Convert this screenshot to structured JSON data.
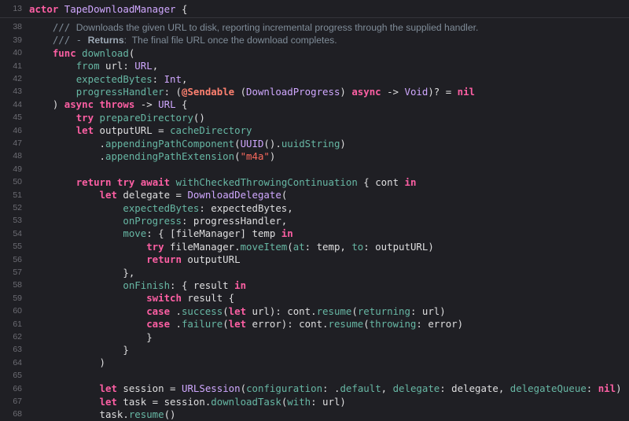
{
  "header": {
    "line_no": "13",
    "parts": [
      {
        "c": "kw",
        "t": "actor"
      },
      {
        "c": "plain",
        "t": " "
      },
      {
        "c": "tp",
        "t": "TapeDownloadManager"
      },
      {
        "c": "plain",
        "t": " {"
      }
    ]
  },
  "lines": [
    {
      "n": "38",
      "p": [
        {
          "c": "plain",
          "t": "    "
        },
        {
          "c": "cmt",
          "t": "/// "
        },
        {
          "c": "doc",
          "t": "Downloads the given URL to disk, reporting incremental progress through the supplied handler."
        }
      ]
    },
    {
      "n": "39",
      "p": [
        {
          "c": "plain",
          "t": "    "
        },
        {
          "c": "cmt",
          "t": "/// - "
        },
        {
          "c": "doc-b",
          "t": "Returns"
        },
        {
          "c": "doc",
          "t": ":  The final file URL once the download completes."
        }
      ]
    },
    {
      "n": "40",
      "p": [
        {
          "c": "plain",
          "t": "    "
        },
        {
          "c": "kw",
          "t": "func"
        },
        {
          "c": "plain",
          "t": " "
        },
        {
          "c": "fn",
          "t": "download"
        },
        {
          "c": "plain",
          "t": "("
        }
      ]
    },
    {
      "n": "41",
      "p": [
        {
          "c": "plain",
          "t": "        "
        },
        {
          "c": "prop",
          "t": "from"
        },
        {
          "c": "plain",
          "t": " url: "
        },
        {
          "c": "tp",
          "t": "URL"
        },
        {
          "c": "plain",
          "t": ","
        }
      ]
    },
    {
      "n": "42",
      "p": [
        {
          "c": "plain",
          "t": "        "
        },
        {
          "c": "prop",
          "t": "expectedBytes"
        },
        {
          "c": "plain",
          "t": ": "
        },
        {
          "c": "tp",
          "t": "Int"
        },
        {
          "c": "plain",
          "t": ","
        }
      ]
    },
    {
      "n": "43",
      "p": [
        {
          "c": "plain",
          "t": "        "
        },
        {
          "c": "prop",
          "t": "progressHandler"
        },
        {
          "c": "plain",
          "t": ": ("
        },
        {
          "c": "attr",
          "t": "@Sendable"
        },
        {
          "c": "plain",
          "t": " ("
        },
        {
          "c": "tp",
          "t": "DownloadProgress"
        },
        {
          "c": "plain",
          "t": ") "
        },
        {
          "c": "kw",
          "t": "async"
        },
        {
          "c": "plain",
          "t": " -> "
        },
        {
          "c": "tp",
          "t": "Void"
        },
        {
          "c": "plain",
          "t": ")? = "
        },
        {
          "c": "kw",
          "t": "nil"
        }
      ]
    },
    {
      "n": "44",
      "p": [
        {
          "c": "plain",
          "t": "    ) "
        },
        {
          "c": "kw",
          "t": "async"
        },
        {
          "c": "plain",
          "t": " "
        },
        {
          "c": "kw",
          "t": "throws"
        },
        {
          "c": "plain",
          "t": " -> "
        },
        {
          "c": "tp",
          "t": "URL"
        },
        {
          "c": "plain",
          "t": " {"
        }
      ]
    },
    {
      "n": "45",
      "p": [
        {
          "c": "plain",
          "t": "        "
        },
        {
          "c": "kw",
          "t": "try"
        },
        {
          "c": "plain",
          "t": " "
        },
        {
          "c": "fn",
          "t": "prepareDirectory"
        },
        {
          "c": "plain",
          "t": "()"
        }
      ]
    },
    {
      "n": "46",
      "p": [
        {
          "c": "plain",
          "t": "        "
        },
        {
          "c": "kw",
          "t": "let"
        },
        {
          "c": "plain",
          "t": " outputURL = "
        },
        {
          "c": "prop",
          "t": "cacheDirectory"
        }
      ]
    },
    {
      "n": "47",
      "p": [
        {
          "c": "plain",
          "t": "            ."
        },
        {
          "c": "fn",
          "t": "appendingPathComponent"
        },
        {
          "c": "plain",
          "t": "("
        },
        {
          "c": "tp",
          "t": "UUID"
        },
        {
          "c": "plain",
          "t": "()."
        },
        {
          "c": "prop",
          "t": "uuidString"
        },
        {
          "c": "plain",
          "t": ")"
        }
      ]
    },
    {
      "n": "48",
      "p": [
        {
          "c": "plain",
          "t": "            ."
        },
        {
          "c": "fn",
          "t": "appendingPathExtension"
        },
        {
          "c": "plain",
          "t": "("
        },
        {
          "c": "str",
          "t": "\"m4a\""
        },
        {
          "c": "plain",
          "t": ")"
        }
      ]
    },
    {
      "n": "49",
      "p": []
    },
    {
      "n": "50",
      "p": [
        {
          "c": "plain",
          "t": "        "
        },
        {
          "c": "kw",
          "t": "return"
        },
        {
          "c": "plain",
          "t": " "
        },
        {
          "c": "kw",
          "t": "try"
        },
        {
          "c": "plain",
          "t": " "
        },
        {
          "c": "kw",
          "t": "await"
        },
        {
          "c": "plain",
          "t": " "
        },
        {
          "c": "fn",
          "t": "withCheckedThrowingContinuation"
        },
        {
          "c": "plain",
          "t": " { cont "
        },
        {
          "c": "kw",
          "t": "in"
        }
      ]
    },
    {
      "n": "51",
      "p": [
        {
          "c": "plain",
          "t": "            "
        },
        {
          "c": "kw",
          "t": "let"
        },
        {
          "c": "plain",
          "t": " delegate = "
        },
        {
          "c": "tp",
          "t": "DownloadDelegate"
        },
        {
          "c": "plain",
          "t": "("
        }
      ]
    },
    {
      "n": "52",
      "p": [
        {
          "c": "plain",
          "t": "                "
        },
        {
          "c": "prop",
          "t": "expectedBytes"
        },
        {
          "c": "plain",
          "t": ": expectedBytes,"
        }
      ]
    },
    {
      "n": "53",
      "p": [
        {
          "c": "plain",
          "t": "                "
        },
        {
          "c": "prop",
          "t": "onProgress"
        },
        {
          "c": "plain",
          "t": ": progressHandler,"
        }
      ]
    },
    {
      "n": "54",
      "p": [
        {
          "c": "plain",
          "t": "                "
        },
        {
          "c": "prop",
          "t": "move"
        },
        {
          "c": "plain",
          "t": ": { [fileManager] temp "
        },
        {
          "c": "kw",
          "t": "in"
        }
      ]
    },
    {
      "n": "55",
      "p": [
        {
          "c": "plain",
          "t": "                    "
        },
        {
          "c": "kw",
          "t": "try"
        },
        {
          "c": "plain",
          "t": " fileManager."
        },
        {
          "c": "fn",
          "t": "moveItem"
        },
        {
          "c": "plain",
          "t": "("
        },
        {
          "c": "prop",
          "t": "at"
        },
        {
          "c": "plain",
          "t": ": temp, "
        },
        {
          "c": "prop",
          "t": "to"
        },
        {
          "c": "plain",
          "t": ": outputURL)"
        }
      ]
    },
    {
      "n": "56",
      "p": [
        {
          "c": "plain",
          "t": "                    "
        },
        {
          "c": "kw",
          "t": "return"
        },
        {
          "c": "plain",
          "t": " outputURL"
        }
      ]
    },
    {
      "n": "57",
      "p": [
        {
          "c": "plain",
          "t": "                },"
        }
      ]
    },
    {
      "n": "58",
      "p": [
        {
          "c": "plain",
          "t": "                "
        },
        {
          "c": "prop",
          "t": "onFinish"
        },
        {
          "c": "plain",
          "t": ": { result "
        },
        {
          "c": "kw",
          "t": "in"
        }
      ]
    },
    {
      "n": "59",
      "p": [
        {
          "c": "plain",
          "t": "                    "
        },
        {
          "c": "kw",
          "t": "switch"
        },
        {
          "c": "plain",
          "t": " result {"
        }
      ]
    },
    {
      "n": "60",
      "p": [
        {
          "c": "plain",
          "t": "                    "
        },
        {
          "c": "kw",
          "t": "case"
        },
        {
          "c": "plain",
          "t": " ."
        },
        {
          "c": "prop",
          "t": "success"
        },
        {
          "c": "plain",
          "t": "("
        },
        {
          "c": "kw",
          "t": "let"
        },
        {
          "c": "plain",
          "t": " url): cont."
        },
        {
          "c": "fn",
          "t": "resume"
        },
        {
          "c": "plain",
          "t": "("
        },
        {
          "c": "prop",
          "t": "returning"
        },
        {
          "c": "plain",
          "t": ": url)"
        }
      ]
    },
    {
      "n": "61",
      "p": [
        {
          "c": "plain",
          "t": "                    "
        },
        {
          "c": "kw",
          "t": "case"
        },
        {
          "c": "plain",
          "t": " ."
        },
        {
          "c": "prop",
          "t": "failure"
        },
        {
          "c": "plain",
          "t": "("
        },
        {
          "c": "kw",
          "t": "let"
        },
        {
          "c": "plain",
          "t": " error): cont."
        },
        {
          "c": "fn",
          "t": "resume"
        },
        {
          "c": "plain",
          "t": "("
        },
        {
          "c": "prop",
          "t": "throwing"
        },
        {
          "c": "plain",
          "t": ": error)"
        }
      ]
    },
    {
      "n": "62",
      "p": [
        {
          "c": "plain",
          "t": "                    }"
        }
      ]
    },
    {
      "n": "63",
      "p": [
        {
          "c": "plain",
          "t": "                }"
        }
      ]
    },
    {
      "n": "64",
      "p": [
        {
          "c": "plain",
          "t": "            )"
        }
      ]
    },
    {
      "n": "65",
      "p": []
    },
    {
      "n": "66",
      "p": [
        {
          "c": "plain",
          "t": "            "
        },
        {
          "c": "kw",
          "t": "let"
        },
        {
          "c": "plain",
          "t": " session = "
        },
        {
          "c": "tp",
          "t": "URLSession"
        },
        {
          "c": "plain",
          "t": "("
        },
        {
          "c": "prop",
          "t": "configuration"
        },
        {
          "c": "plain",
          "t": ": ."
        },
        {
          "c": "prop",
          "t": "default"
        },
        {
          "c": "plain",
          "t": ", "
        },
        {
          "c": "prop",
          "t": "delegate"
        },
        {
          "c": "plain",
          "t": ": delegate, "
        },
        {
          "c": "prop",
          "t": "delegateQueue"
        },
        {
          "c": "plain",
          "t": ": "
        },
        {
          "c": "kw",
          "t": "nil"
        },
        {
          "c": "plain",
          "t": ")"
        }
      ]
    },
    {
      "n": "67",
      "p": [
        {
          "c": "plain",
          "t": "            "
        },
        {
          "c": "kw",
          "t": "let"
        },
        {
          "c": "plain",
          "t": " task = session."
        },
        {
          "c": "fn",
          "t": "downloadTask"
        },
        {
          "c": "plain",
          "t": "("
        },
        {
          "c": "prop",
          "t": "with"
        },
        {
          "c": "plain",
          "t": ": url)"
        }
      ]
    },
    {
      "n": "68",
      "p": [
        {
          "c": "plain",
          "t": "            task."
        },
        {
          "c": "fn",
          "t": "resume"
        },
        {
          "c": "plain",
          "t": "()"
        }
      ]
    }
  ]
}
